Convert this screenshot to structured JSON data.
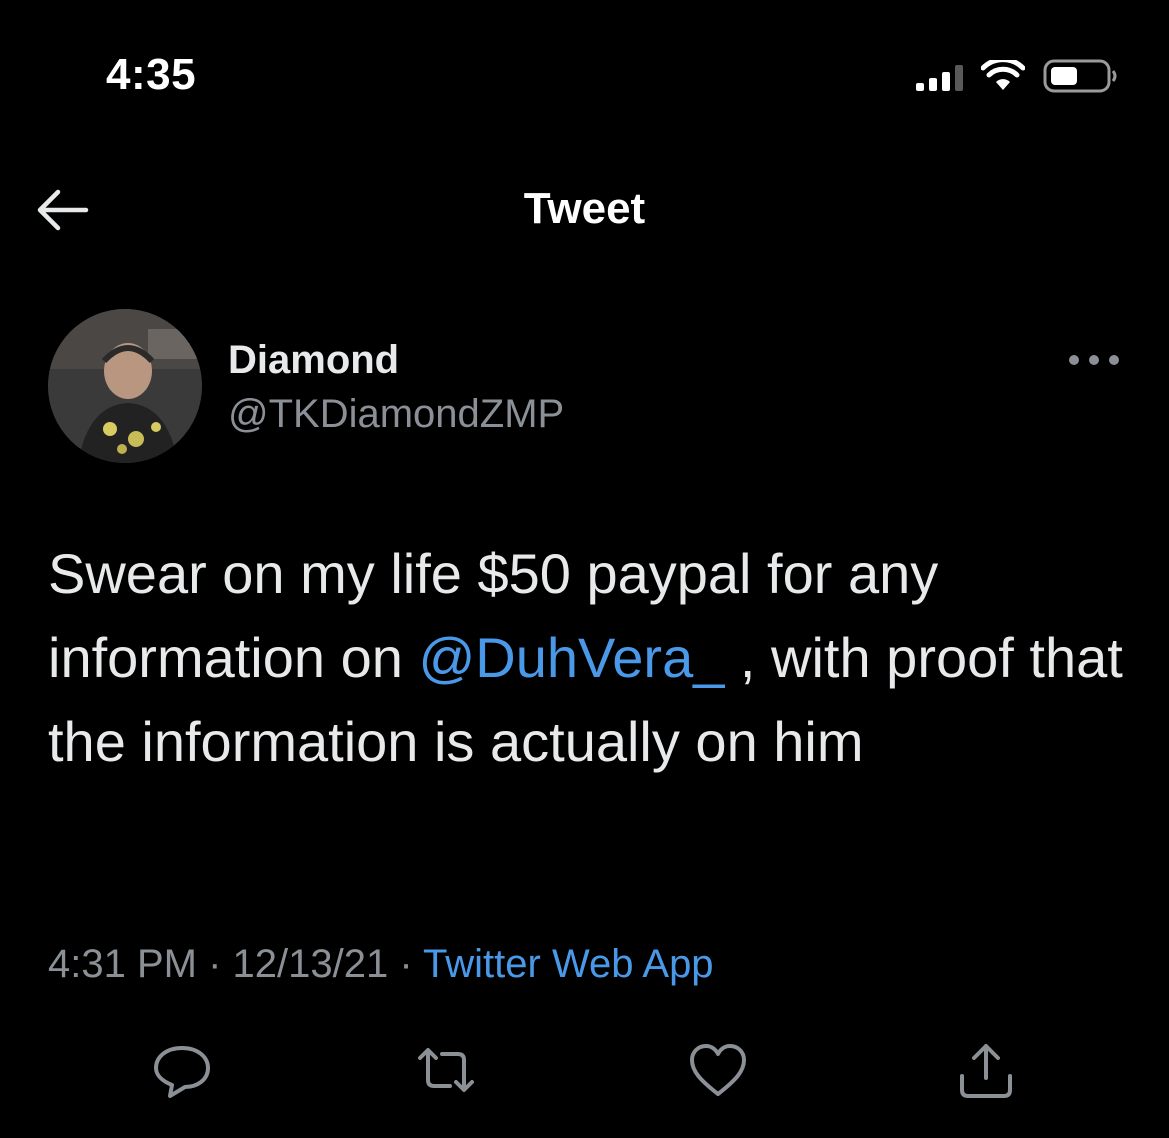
{
  "status_bar": {
    "time": "4:35",
    "icons": [
      "cellular-signal-icon",
      "wifi-icon",
      "battery-icon"
    ]
  },
  "header": {
    "title": "Tweet",
    "back_icon": "back-arrow-icon"
  },
  "author": {
    "name": "Diamond",
    "handle": "@TKDiamondZMP"
  },
  "tweet": {
    "text_before": "Swear on my life $50 paypal for any information on ",
    "mention": "@DuhVera_",
    "text_after": " , with proof that the information is actually on him"
  },
  "meta": {
    "time": "4:31 PM",
    "separator": " · ",
    "date": "12/13/21",
    "source": "Twitter Web App"
  },
  "actions": [
    "reply-icon",
    "retweet-icon",
    "like-icon",
    "share-icon"
  ],
  "colors": {
    "background": "#000000",
    "text": "#e7e9ea",
    "secondary_text": "#8b9096",
    "link": "#4a99e9"
  }
}
